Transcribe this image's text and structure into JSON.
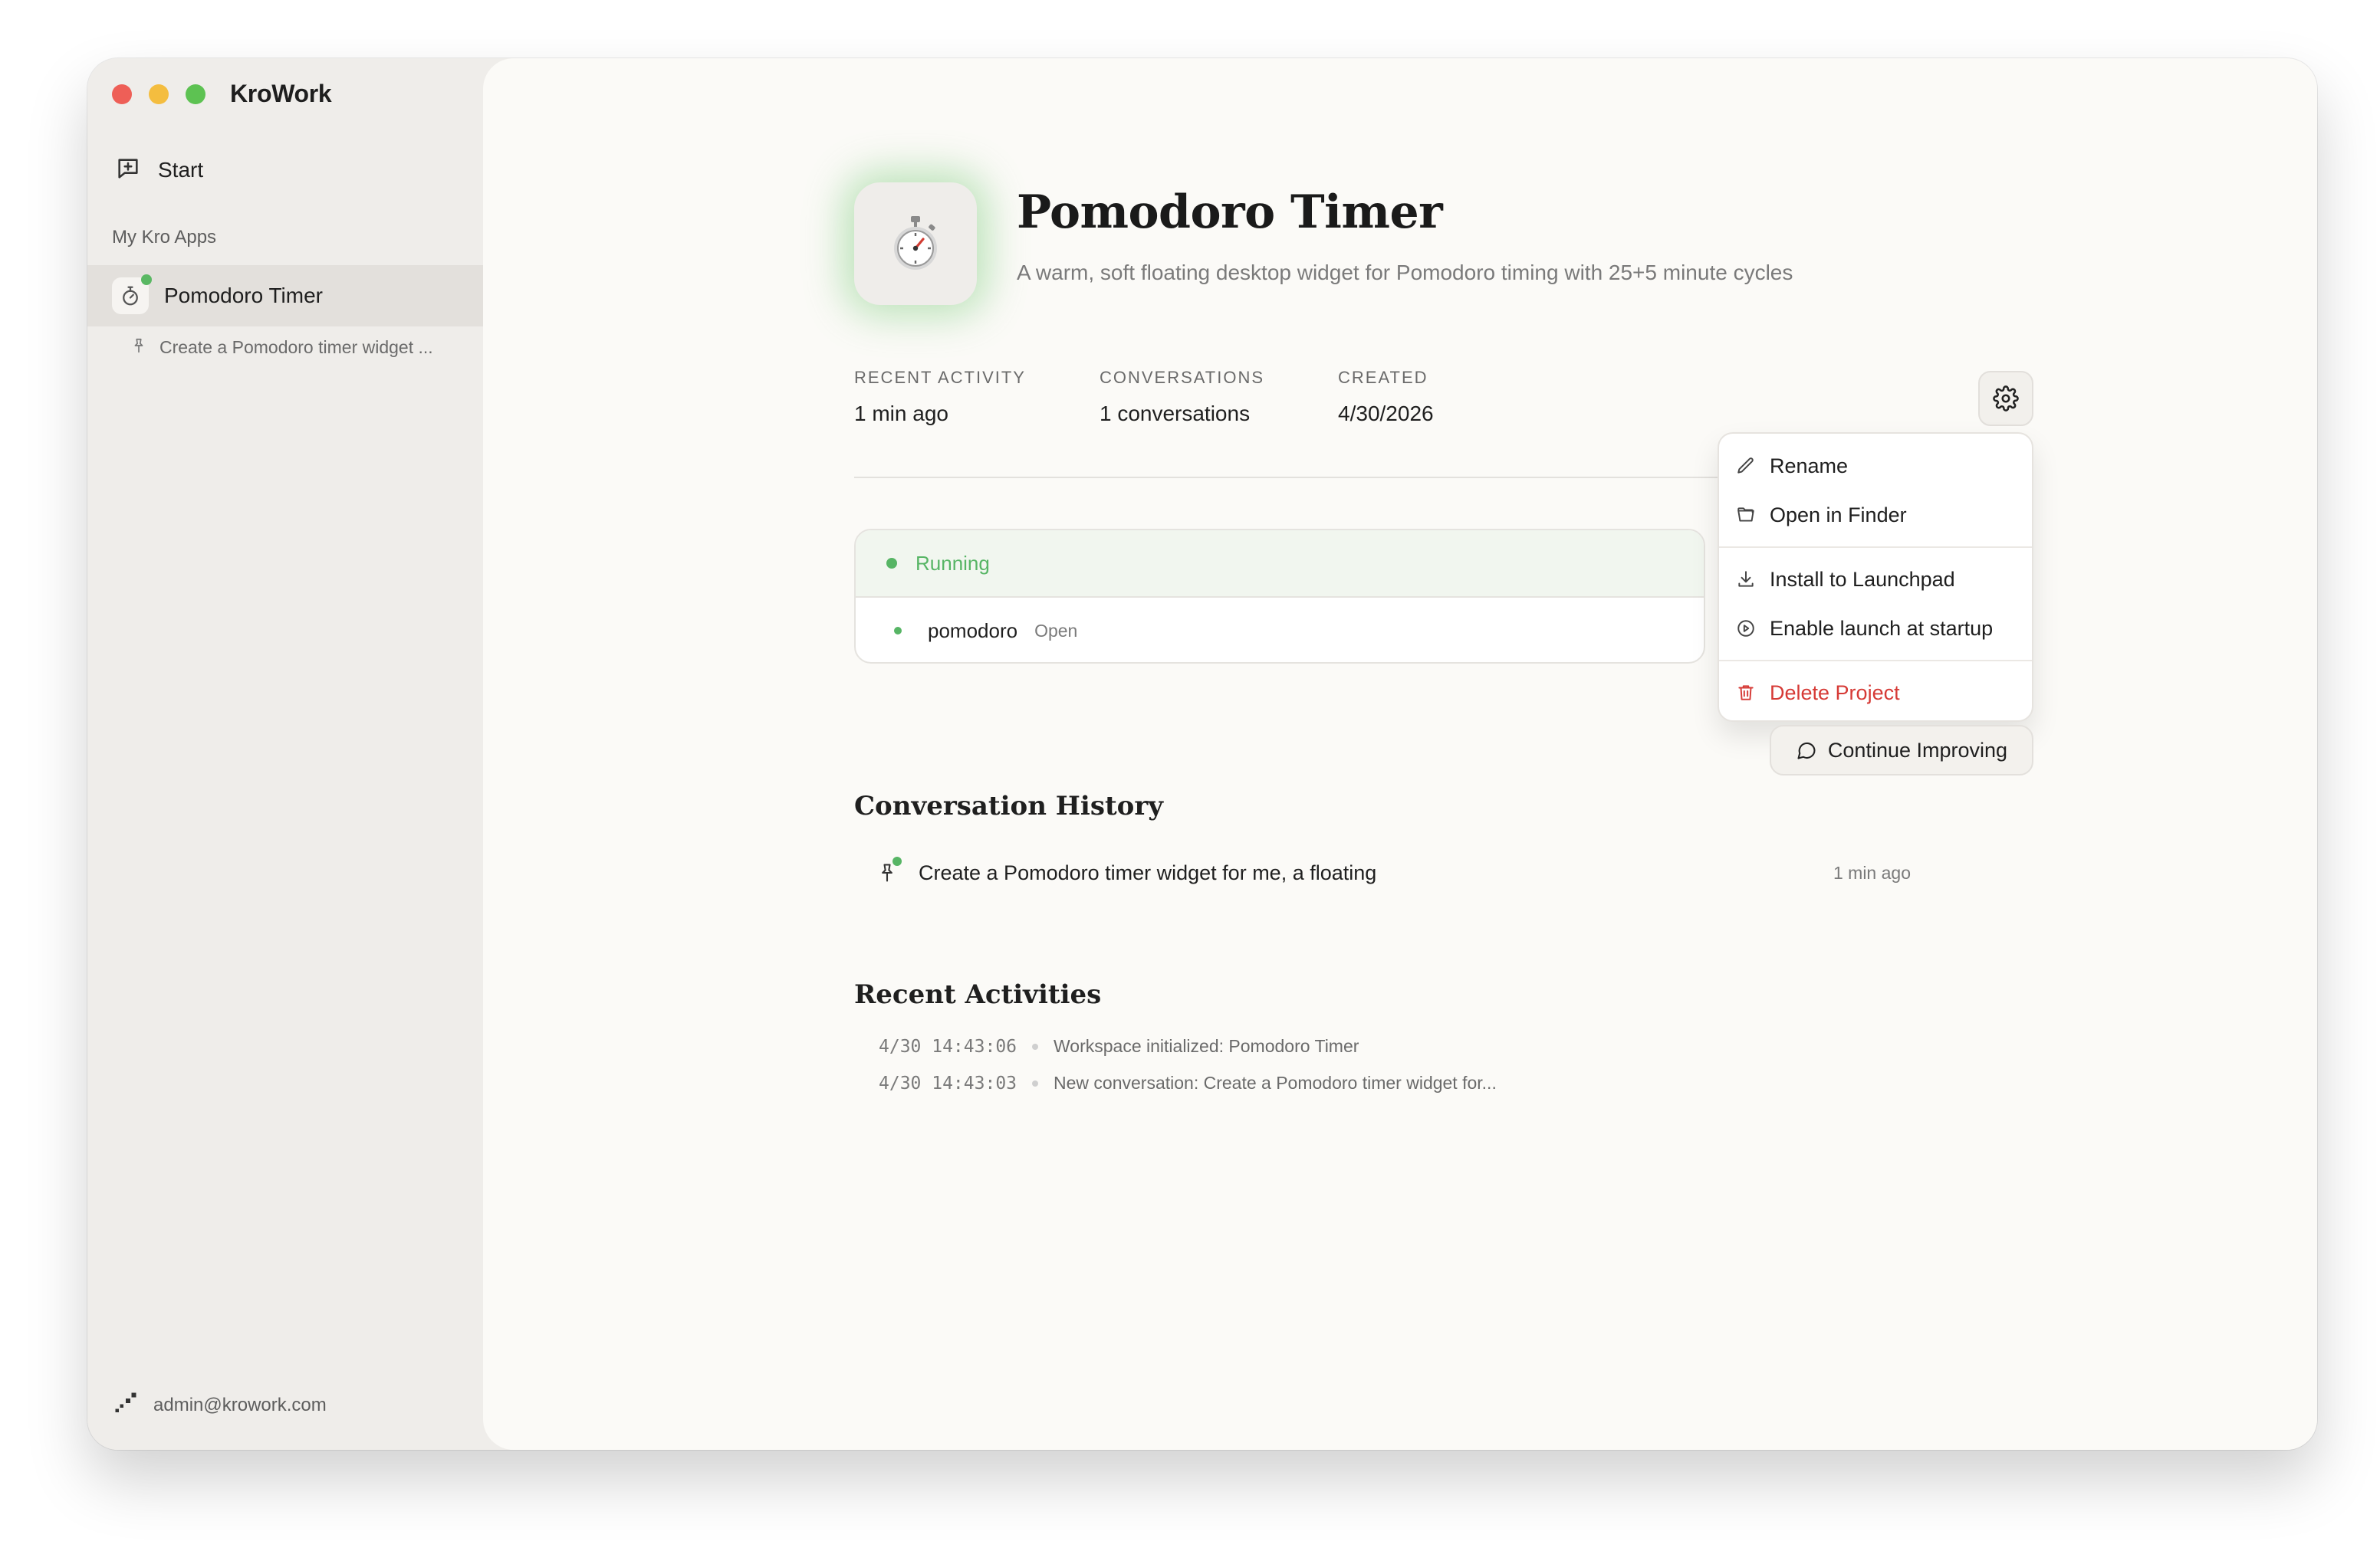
{
  "app": {
    "title": "KroWork"
  },
  "sidebar": {
    "start_label": "Start",
    "section_label": "My Kro Apps",
    "app_item": {
      "label": "Pomodoro Timer",
      "icon": "stopwatch-icon"
    },
    "conversation_item": {
      "label": "Create a Pomodoro timer widget ..."
    },
    "user_email": "admin@krowork.com"
  },
  "project": {
    "title": "Pomodoro Timer",
    "description": "A warm, soft floating desktop widget for Pomodoro timing with 25+5 minute cycles",
    "icon_glyph": "⏱️"
  },
  "stats": {
    "recent_activity_label": "RECENT ACTIVITY",
    "recent_activity_value": "1 min ago",
    "conversations_label": "CONVERSATIONS",
    "conversations_value": "1 conversations",
    "created_label": "CREATED",
    "created_value": "4/30/2026"
  },
  "status": {
    "state": "Running",
    "process_name": "pomodoro",
    "open_label": "Open",
    "color": "#57b565"
  },
  "menu": {
    "rename": "Rename",
    "open_in_finder": "Open in Finder",
    "install_launchpad": "Install to Launchpad",
    "launch_at_startup": "Enable launch at startup",
    "delete_project": "Delete Project",
    "danger_color": "#d63a36"
  },
  "history": {
    "title": "Conversation History",
    "continue_label": "Continue Improving",
    "items": [
      {
        "text": "Create a Pomodoro timer widget for me, a floating",
        "time": "1 min ago"
      }
    ]
  },
  "activities": {
    "title": "Recent Activities",
    "items": [
      {
        "ts": "4/30 14:43:06",
        "text": "Workspace initialized: Pomodoro Timer"
      },
      {
        "ts": "4/30 14:43:03",
        "text": "New conversation: Create a Pomodoro timer widget for..."
      }
    ]
  }
}
